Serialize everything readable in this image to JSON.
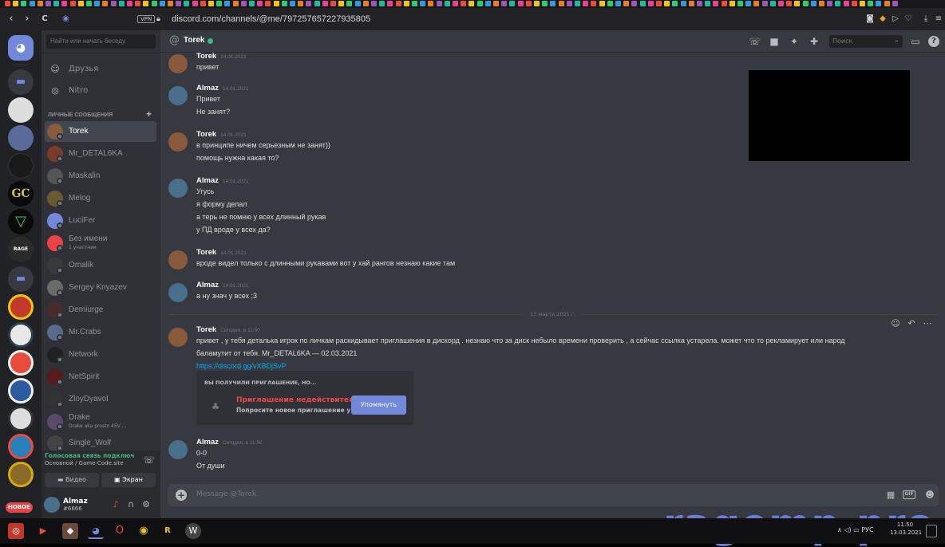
{
  "browser": {
    "vpn_label": "VPN",
    "url": "discord.com/channels/@me/797257657227935805",
    "nav": {
      "back": "‹",
      "forward": "›",
      "reload": "C"
    }
  },
  "sidebar": {
    "search_placeholder": "Найти или начать беседу",
    "nav_items": [
      {
        "label": "Друзья"
      },
      {
        "label": "Nitro"
      }
    ],
    "dm_header": "ЛИЧНЫЕ СООБЩЕНИЯ",
    "dm_add": "+",
    "dms": [
      {
        "name": "Torek",
        "sub": "",
        "active": true,
        "color": "#8a5a3c"
      },
      {
        "name": "Mr_DETAL6KA",
        "sub": "",
        "color": "#7a3a2a"
      },
      {
        "name": "Maskalin",
        "sub": "",
        "color": "#555"
      },
      {
        "name": "Melog",
        "sub": "",
        "color": "#6a5a30"
      },
      {
        "name": "LuciFer",
        "sub": "",
        "color": "#7289da"
      },
      {
        "name": "Без имени",
        "sub": "1 участник",
        "color": "#ed4245"
      },
      {
        "name": "Omalik",
        "sub": "",
        "color": "#3a3a3a"
      },
      {
        "name": "Sergey Knyazev",
        "sub": "",
        "color": "#6a6a6a"
      },
      {
        "name": "Demiurge",
        "sub": "",
        "color": "#4a2a2a"
      },
      {
        "name": "Mr.Crabs",
        "sub": "",
        "color": "#5a6a8a"
      },
      {
        "name": "Network",
        "sub": "",
        "color": "#222"
      },
      {
        "name": "NetSpirit",
        "sub": "",
        "color": "#5a1a1a"
      },
      {
        "name": "ZloyDyavol",
        "sub": "",
        "color": "#333"
      },
      {
        "name": "Drake",
        "sub": "Drake aka prosto 45V ...",
        "color": "#5a4a6a"
      },
      {
        "name": "Single_Wolf",
        "sub": "",
        "color": "#444"
      }
    ],
    "voice": {
      "connected": "Голосовая связь подключ",
      "info": "Основной / Game-Code.site",
      "video_btn": "Видео",
      "screen_btn": "Экран"
    },
    "user": {
      "name": "Almaz",
      "tag": "#6666"
    }
  },
  "guilds": {
    "new_badge": "НОВОЕ",
    "gc_label": "GC",
    "rage_label": "RAGE"
  },
  "chat": {
    "channel_name": "Torek",
    "search_placeholder": "Поиск",
    "date_divider": "13 марта 2021 г.",
    "composer_placeholder": "Message @Torek",
    "gif_label": "GIF",
    "messages": [
      {
        "author": "Torek",
        "ts": "14.01.2021",
        "lines": [
          "привет"
        ]
      },
      {
        "author": "Almaz",
        "ts": "14.01.2021",
        "lines": [
          "Привет",
          "Не занят?"
        ]
      },
      {
        "author": "Torek",
        "ts": "14.01.2021",
        "lines": [
          "в принципе ничем серьезным не занят))",
          "помощь нужна какая то?"
        ]
      },
      {
        "author": "Almaz",
        "ts": "14.01.2021",
        "lines": [
          "Угусь",
          "я форму делал",
          "а терь не помню у всех длинный рукав",
          "у ПД вроде у всех да?"
        ]
      },
      {
        "author": "Torek",
        "ts": "14.01.2021",
        "lines": [
          "вроде видел только с длинными рукавами   вот у хай рангов незнаю  какие там"
        ]
      },
      {
        "author": "Almaz",
        "ts": "14.01.2021",
        "lines": [
          "а ну знач у всех ;3"
        ]
      },
      {
        "author": "Torek",
        "ts": "Сегодня, в 11:50",
        "lines": [
          "привет , у тебя деталька  игрок по личкам раскидывает приглашения в дискорд . незнаю что за диск  небыло времени  проверить , а сейчас  ссылка устарела.  может что то рекламирует или народ",
          "баламутит от тебя.  Mr_DETAL6KA — 02.03.2021"
        ],
        "link": "https://discord.gg/vXBDjSvP"
      },
      {
        "author": "Almaz",
        "ts": "Сегодня, в 11:50",
        "lines": [
          "0-0",
          "От души"
        ]
      }
    ],
    "invite": {
      "title": "ВЫ ПОЛУЧИЛИ ПРИГЛАШЕНИЕ, НО...",
      "invalid": "Приглашение недействител...",
      "sub": "Попросите новое приглашение у ...",
      "button": "Упомянуть"
    }
  },
  "watermark": "ragemp.pro",
  "taskbar": {
    "lang": "РУС",
    "time": "11:50",
    "date": "13.03.2021"
  }
}
